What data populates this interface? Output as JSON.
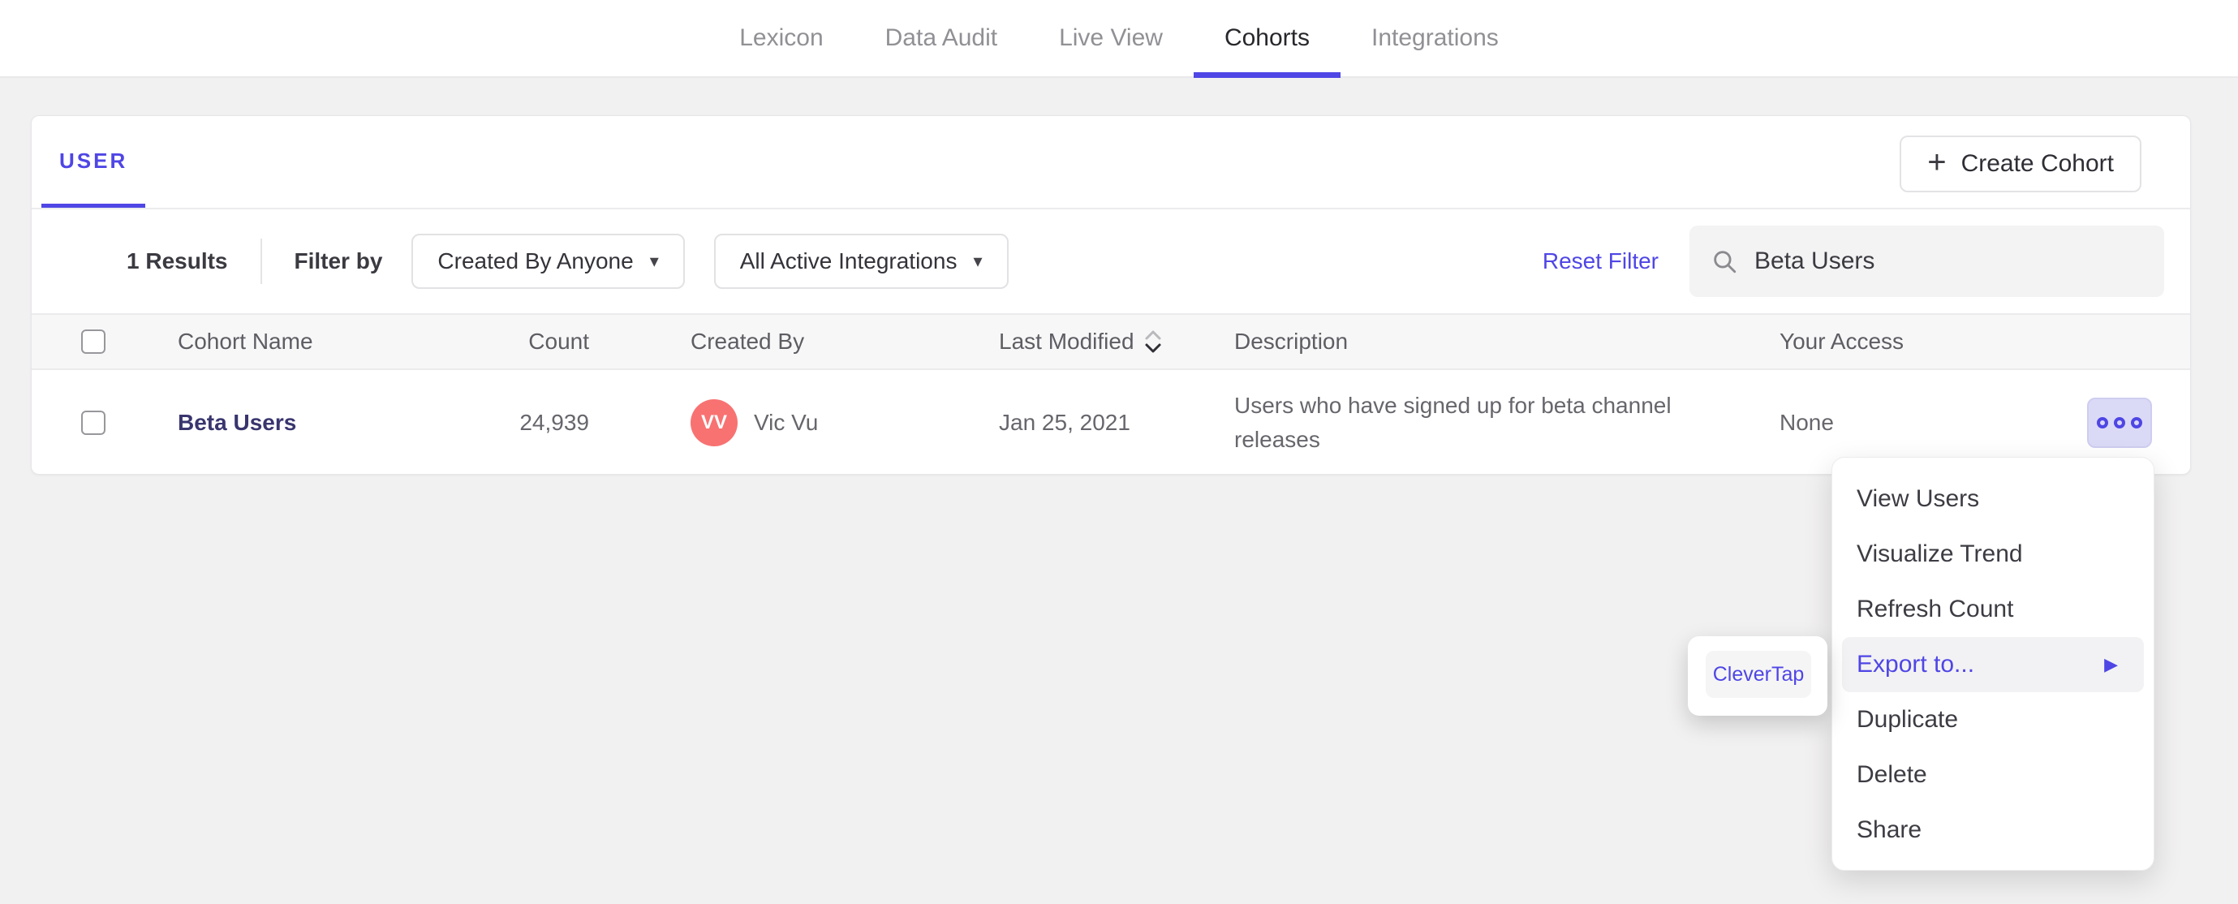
{
  "nav": {
    "items": [
      {
        "label": "Lexicon",
        "active": false
      },
      {
        "label": "Data Audit",
        "active": false
      },
      {
        "label": "Live View",
        "active": false
      },
      {
        "label": "Cohorts",
        "active": true
      },
      {
        "label": "Integrations",
        "active": false
      }
    ]
  },
  "tabs": {
    "user_label": "USER"
  },
  "toolbar": {
    "create_cohort_label": "Create Cohort",
    "plus_icon": "+"
  },
  "filters": {
    "results_count": "1 Results",
    "filter_by_label": "Filter by",
    "created_by_dropdown": {
      "label": "Created By Anyone",
      "caret_icon": "▾"
    },
    "integrations_dropdown": {
      "label": "All Active Integrations",
      "caret_icon": "▾"
    },
    "reset_label": "Reset Filter",
    "search": {
      "value": "Beta Users"
    }
  },
  "table": {
    "headers": {
      "cohort_name": "Cohort Name",
      "count": "Count",
      "created_by": "Created By",
      "last_modified": "Last Modified",
      "description": "Description",
      "your_access": "Your Access"
    },
    "sort": {
      "column": "last_modified",
      "direction": "descending"
    },
    "row": {
      "name": "Beta Users",
      "count": "24,939",
      "creator_initials": "VV",
      "creator_name": "Vic Vu",
      "last_modified": "Jan 25, 2021",
      "description": "Users who have signed up for beta channel releases",
      "access": "None"
    }
  },
  "menu": {
    "submenu_arrow_icon": "▶",
    "items": [
      {
        "label": "View Users",
        "highlighted": false
      },
      {
        "label": "Visualize Trend",
        "highlighted": false
      },
      {
        "label": "Refresh Count",
        "highlighted": false
      },
      {
        "label": "Export to...",
        "highlighted": true,
        "has_submenu": true
      },
      {
        "label": "Duplicate",
        "highlighted": false
      },
      {
        "label": "Delete",
        "highlighted": false
      },
      {
        "label": "Share",
        "highlighted": false
      }
    ]
  },
  "submenu": {
    "items": [
      {
        "label": "CleverTap"
      }
    ]
  },
  "colors": {
    "accent": "#4f46e5",
    "accent_light_bg": "#dbdaf6",
    "avatar_bg": "#f87272",
    "cohort_link": "#39356e",
    "page_bg": "#f2f1f1",
    "header_row_bg": "#f7f7f8"
  }
}
